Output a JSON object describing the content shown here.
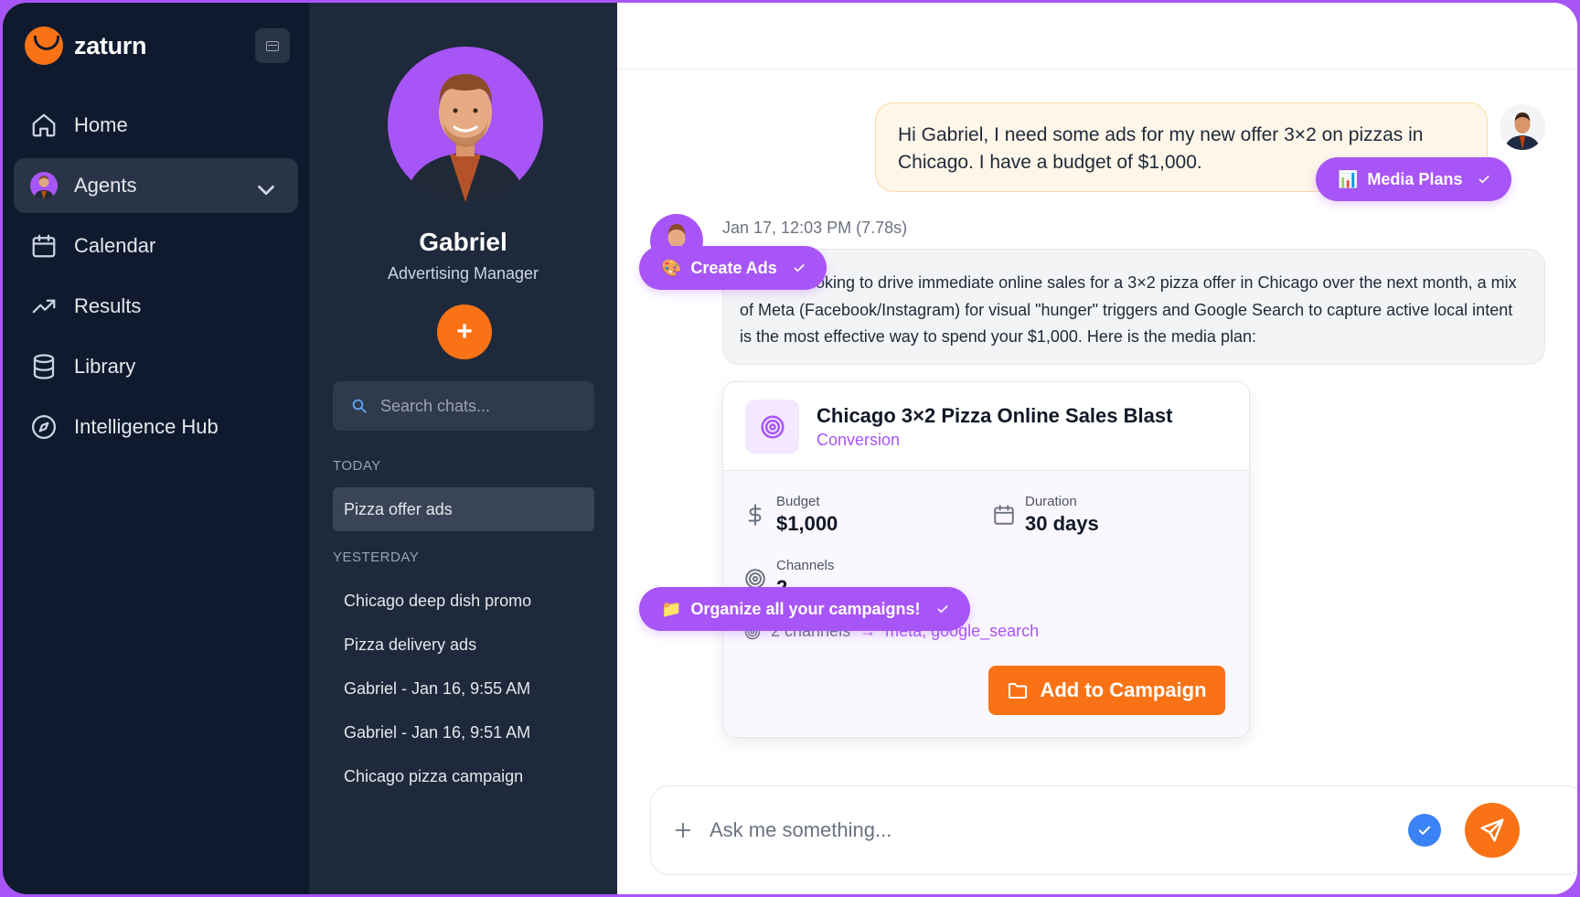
{
  "brand": {
    "name": "zaturn"
  },
  "nav": {
    "items": [
      {
        "label": "Home",
        "icon": "home-icon"
      },
      {
        "label": "Agents",
        "icon": "agent-avatar"
      },
      {
        "label": "Calendar",
        "icon": "calendar-icon"
      },
      {
        "label": "Results",
        "icon": "trending-up-icon"
      },
      {
        "label": "Library",
        "icon": "database-icon"
      },
      {
        "label": "Intelligence Hub",
        "icon": "compass-icon"
      }
    ],
    "active": "Agents"
  },
  "agent": {
    "name": "Gabriel",
    "role": "Advertising Manager",
    "new_chat_label": "+",
    "search_placeholder": "Search chats..."
  },
  "chats": {
    "today_label": "TODAY",
    "today": [
      "Pizza offer ads"
    ],
    "yesterday_label": "YESTERDAY",
    "yesterday": [
      "Chicago deep dish promo",
      "Pizza delivery ads",
      "Gabriel - Jan 16, 9:55 AM",
      "Gabriel - Jan 16, 9:51 AM",
      "Chicago pizza campaign"
    ]
  },
  "conversation": {
    "user_message": "Hi Gabriel, I need some ads for my new offer 3×2 on pizzas in Chicago. I have a budget of $1,000.",
    "timestamp": "Jan 17, 12:03 PM (7.78s)",
    "bot_message": "re looking to drive immediate online sales for a 3×2 pizza offer in Chicago over the next month, a mix of Meta (Facebook/Instagram) for visual \"hunger\" triggers and Google Search to capture active local intent is the most effective way to spend your $1,000. Here is the media plan:"
  },
  "pills": {
    "media_plans": {
      "emoji": "📊",
      "label": "Media Plans"
    },
    "create_ads": {
      "emoji": "🎨",
      "label": "Create Ads"
    },
    "organize": {
      "emoji": "📁",
      "label": "Organize all your campaigns!"
    }
  },
  "media_plan": {
    "title": "Chicago 3×2 Pizza Online Sales Blast",
    "objective": "Conversion",
    "budget_label": "Budget",
    "budget_value": "$1,000",
    "duration_label": "Duration",
    "duration_value": "30 days",
    "channels_label": "Channels",
    "channels_value": "2",
    "channels_count": "2 channels",
    "channels_arrow": "→",
    "channels_list": "meta, google_search",
    "add_button": "Add to Campaign"
  },
  "composer": {
    "placeholder": "Ask me something...",
    "add_label": "+"
  },
  "colors": {
    "accent_purple": "#a855f7",
    "accent_orange": "#f97316",
    "nav_bg": "#0f1a2e",
    "panel_bg": "#1e293b"
  }
}
